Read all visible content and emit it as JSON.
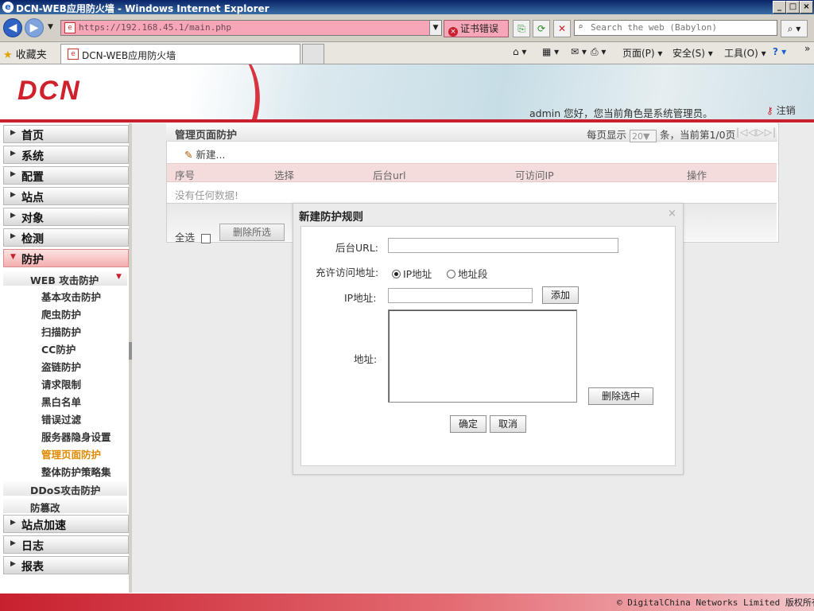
{
  "window": {
    "title": "DCN-WEB应用防火墙 - Windows Internet Explorer",
    "min": "_",
    "max": "□",
    "close": "×"
  },
  "addressbar": {
    "url": "https://192.168.45.1/main.php",
    "cert_error": "证书错误",
    "search_placeholder": "Search the web (Babylon)"
  },
  "favbar": {
    "favorites": "收藏夹",
    "tab_title": "DCN-WEB应用防火墙",
    "page_menu": "页面(P)",
    "safety_menu": "安全(S)",
    "tools_menu": "工具(O)"
  },
  "header": {
    "logo": "DCN",
    "user_info": "admin 您好，您当前角色是系统管理员。",
    "logout": "注销"
  },
  "sidebar": {
    "menus": [
      "首页",
      "系统",
      "配置",
      "站点",
      "对象",
      "检测",
      "防护"
    ],
    "web_attack": "WEB 攻击防护",
    "sub_items": [
      "基本攻击防护",
      "爬虫防护",
      "扫描防护",
      "CC防护",
      "盗链防护",
      "请求限制",
      "黑白名单",
      "错误过滤",
      "服务器隐身设置",
      "管理页面防护",
      "整体防护策略集"
    ],
    "ddos": "DDoS攻击防护",
    "tamper": "防篡改",
    "bottom_menus": [
      "站点加速",
      "日志",
      "报表"
    ]
  },
  "panel": {
    "title": "管理页面防护",
    "paging_prefix": "每页显示",
    "page_size": "20",
    "paging_suffix": "条，当前第1/0页",
    "new": "新建...",
    "columns": [
      "序号",
      "选择",
      "后台url",
      "可访问IP",
      "操作"
    ],
    "empty": "没有任何数据!",
    "select_all": "全选",
    "delete_selected": "删除所选"
  },
  "modal": {
    "title": "新建防护规则",
    "close": "×",
    "url_label": "后台URL:",
    "allow_label": "充许访问地址:",
    "opt_ip": "IP地址",
    "opt_range": "地址段",
    "ip_label": "IP地址:",
    "add": "添加",
    "addr_label": "地址:",
    "delete_selected": "删除选中",
    "ok": "确定",
    "cancel": "取消"
  },
  "footer": {
    "copyright": "© DigitalChina Networks Limited 版权所有"
  }
}
